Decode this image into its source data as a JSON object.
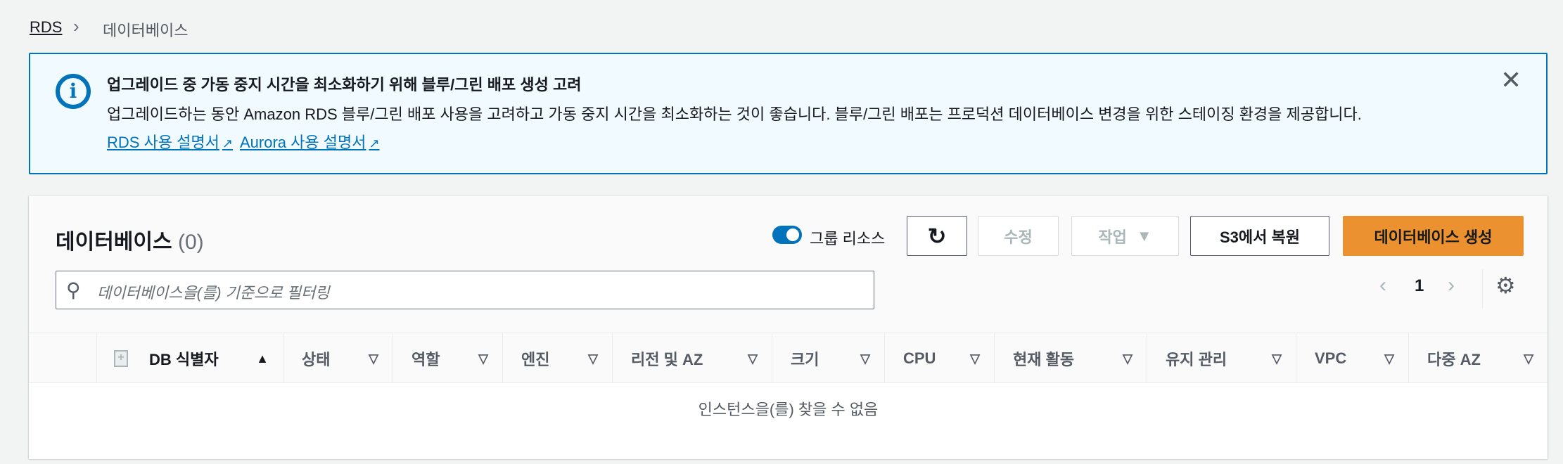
{
  "breadcrumb": {
    "root": "RDS",
    "separator": "›",
    "current": "데이터베이스"
  },
  "alert": {
    "title": "업그레이드 중 가동 중지 시간을 최소화하기 위해 블루/그린 배포 생성 고려",
    "body": "업그레이드하는 동안 Amazon RDS 블루/그린 배포 사용을 고려하고 가동 중지 시간을 최소화하는 것이 좋습니다. 블루/그린 배포는 프로덕션 데이터베이스 변경을 위한 스테이징 환경을 제공합니다.",
    "links": [
      "RDS 사용 설명서",
      "Aurora 사용 설명서"
    ]
  },
  "panel": {
    "title": "데이터베이스",
    "count": "(0)",
    "toggle_label": "그룹 리소스",
    "toggle_on": true,
    "buttons": {
      "modify": "수정",
      "actions": "작업",
      "restore": "S3에서 복원",
      "create": "데이터베이스 생성"
    },
    "search_placeholder": "데이터베이스을(를) 기준으로 필터링",
    "page": "1",
    "columns": [
      "DB 식별자",
      "상태",
      "역할",
      "엔진",
      "리전 및 AZ",
      "크기",
      "CPU",
      "현재 활동",
      "유지 관리",
      "VPC",
      "다중 AZ"
    ],
    "empty": "인스턴스을(를) 찾을 수 없음"
  },
  "colors": {
    "accent": "#0073bb",
    "primary": "#ec9130"
  }
}
